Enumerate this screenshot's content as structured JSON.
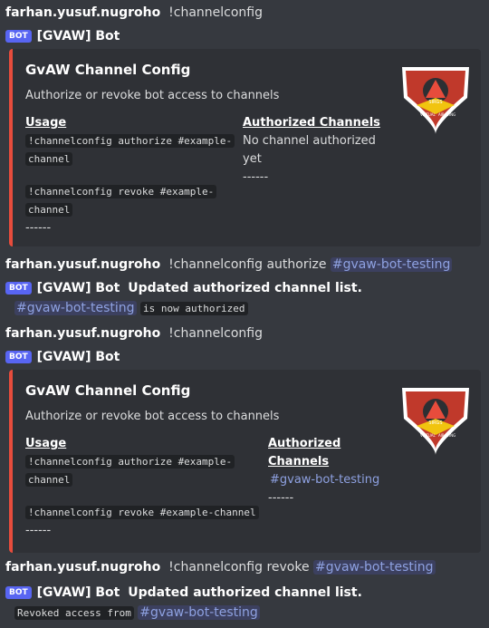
{
  "messages": {
    "m1": {
      "username": "farhan.yusuf.nugroho",
      "command": "!channelconfig"
    },
    "bot1": {
      "badge": "BOT",
      "name": "[GVAW] Bot"
    },
    "embed1": {
      "title": "GvAW Channel Config",
      "description": "Authorize or revoke bot access to channels",
      "usage_label": "Usage",
      "usage_line1a": "!channelconfig authorize #example-",
      "usage_line1b": "channel",
      "usage_line2a": "!channelconfig revoke #example-",
      "usage_line2b": "channel",
      "usage_sep": "------",
      "auth_label": "Authorized Channels",
      "auth_value": "No channel authorized yet",
      "auth_sep": "------",
      "logo_text_top": "SIRGS",
      "logo_text_bottom_left": "VIRTUAL",
      "logo_text_bottom_right": "AIR WING"
    },
    "m2": {
      "username": "farhan.yusuf.nugroho",
      "command": "!channelconfig authorize",
      "mention": "#gvaw-bot-testing"
    },
    "bot2": {
      "badge": "BOT",
      "name": "[GVAW] Bot",
      "text": "Updated authorized channel list."
    },
    "bot2_line2": {
      "mention": "#gvaw-bot-testing",
      "text": "is now authorized"
    },
    "m3": {
      "username": "farhan.yusuf.nugroho",
      "command": "!channelconfig"
    },
    "bot3": {
      "badge": "BOT",
      "name": "[GVAW] Bot"
    },
    "embed2": {
      "title": "GvAW Channel Config",
      "description": "Authorize or revoke bot access to channels",
      "usage_label": "Usage",
      "usage_line1a": "!channelconfig authorize #example-",
      "usage_line1b": "channel",
      "usage_line2": "!channelconfig revoke #example-channel",
      "usage_sep": "------",
      "auth_label": "Authorized Channels",
      "auth_value": "#gvaw-bot-testing",
      "auth_sep": "------"
    },
    "m4": {
      "username": "farhan.yusuf.nugroho",
      "command": "!channelconfig revoke",
      "mention": "#gvaw-bot-testing"
    },
    "bot4": {
      "badge": "BOT",
      "name": "[GVAW] Bot",
      "text": "Updated authorized channel list."
    },
    "bot4_line2": {
      "text": "Revoked access from",
      "mention": "#gvaw-bot-testing"
    }
  },
  "colors": {
    "embed_border": "#e74c3c",
    "mention": "#8ea1e1",
    "badge": "#5865f2",
    "background": "#36393f",
    "embed_bg": "#2f3136"
  },
  "icons": {
    "logo": "gvaw-logo-icon"
  }
}
